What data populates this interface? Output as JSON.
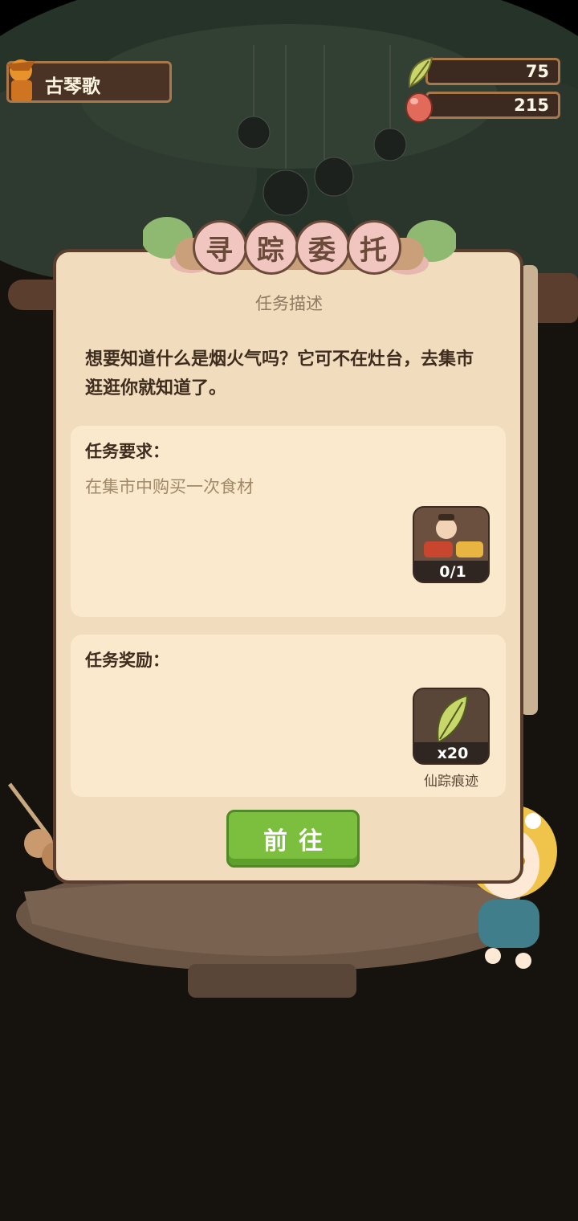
{
  "player": {
    "name": "古琴歌",
    "avatar_icon": "scarecrow-avatar-icon"
  },
  "resources": [
    {
      "icon": "leaf-wing-icon",
      "value": "75"
    },
    {
      "icon": "red-egg-icon",
      "value": "215"
    }
  ],
  "panel": {
    "title_chars": [
      "寻",
      "踪",
      "委",
      "托"
    ],
    "section_label": "任务描述",
    "description": "想要知道什么是烟火气吗？它可不在灶台，去集市逛逛你就知道了。",
    "requirement": {
      "title": "任务要求：",
      "text": "在集市中购买一次食材",
      "item": {
        "icon": "market-vendor-icon",
        "progress": "0/1"
      }
    },
    "reward": {
      "title": "任务奖励：",
      "item": {
        "icon": "leaf-wing-icon",
        "count": "x20",
        "name": "仙踪痕迹"
      }
    },
    "go_button": "前往"
  },
  "colors": {
    "panel_bg": "#f1ddbd",
    "card_bg": "#fbe9cd",
    "button_green": "#7cbe3e",
    "badge_pink": "#f1c6c0"
  }
}
